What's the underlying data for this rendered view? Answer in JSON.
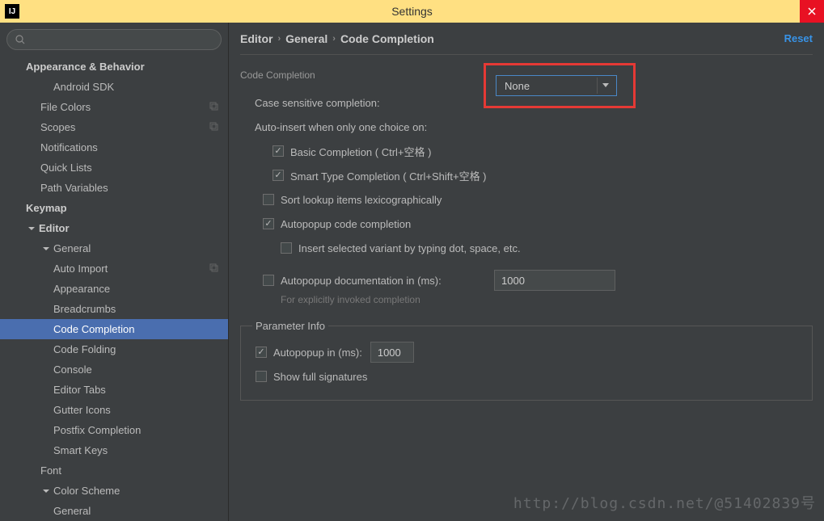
{
  "window": {
    "title": "Settings"
  },
  "search": {
    "placeholder": ""
  },
  "header": {
    "crumb1": "Editor",
    "crumb2": "General",
    "crumb3": "Code Completion",
    "reset": "Reset"
  },
  "tree": {
    "appearance_behavior": "Appearance & Behavior",
    "android_sdk": "Android SDK",
    "file_colors": "File Colors",
    "scopes": "Scopes",
    "notifications": "Notifications",
    "quick_lists": "Quick Lists",
    "path_variables": "Path Variables",
    "keymap": "Keymap",
    "editor": "Editor",
    "general": "General",
    "auto_import": "Auto Import",
    "appearance": "Appearance",
    "breadcrumbs": "Breadcrumbs",
    "code_completion": "Code Completion",
    "code_folding": "Code Folding",
    "console": "Console",
    "editor_tabs": "Editor Tabs",
    "gutter_icons": "Gutter Icons",
    "postfix_completion": "Postfix Completion",
    "smart_keys": "Smart Keys",
    "font": "Font",
    "color_scheme": "Color Scheme",
    "cs_general": "General"
  },
  "form": {
    "section_title": "Code Completion",
    "case_sensitive": "Case sensitive completion:",
    "case_sensitive_value": "None",
    "auto_insert_label": "Auto-insert when only one choice on:",
    "basic": "Basic Completion ( Ctrl+空格 )",
    "smart": "Smart Type Completion ( Ctrl+Shift+空格 )",
    "sort_lookup": "Sort lookup items lexicographically",
    "autopopup_code": "Autopopup code completion",
    "insert_variant": "Insert selected variant by typing dot, space, etc.",
    "autopopup_doc": "Autopopup documentation in (ms):",
    "autopopup_doc_value": "1000",
    "autopopup_doc_hint": "For explicitly invoked completion",
    "param_legend": "Parameter Info",
    "param_autopopup": "Autopopup in (ms):",
    "param_autopopup_value": "1000",
    "show_full_sig": "Show full signatures"
  },
  "watermark": "http://blog.csdn.net/@51402839号"
}
